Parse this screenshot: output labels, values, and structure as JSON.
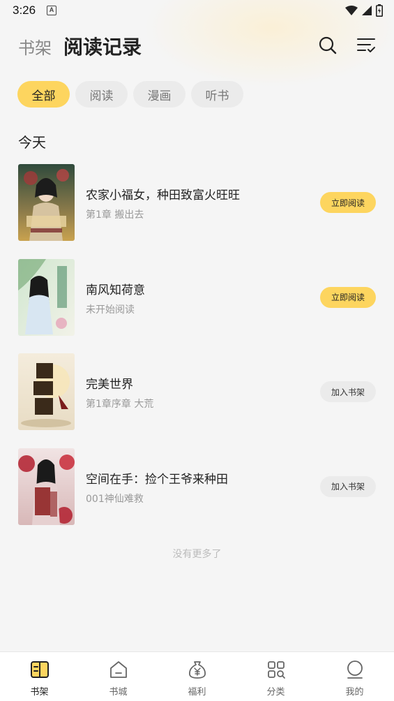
{
  "status": {
    "time": "3:26",
    "a_badge": "A"
  },
  "header": {
    "tab_shelf": "书架",
    "tab_history": "阅读记录",
    "search_icon": "search-icon",
    "manage_icon": "list-check-icon"
  },
  "filters": [
    {
      "label": "全部",
      "active": true
    },
    {
      "label": "阅读",
      "active": false
    },
    {
      "label": "漫画",
      "active": false
    },
    {
      "label": "听书",
      "active": false
    }
  ],
  "section_title": "今天",
  "books": [
    {
      "title": "农家小福女，种田致富火旺旺",
      "subtitle": "第1章 搬出去",
      "action": "立即阅读",
      "action_type": "read"
    },
    {
      "title": "南风知荷意",
      "subtitle": "未开始阅读",
      "action": "立即阅读",
      "action_type": "read"
    },
    {
      "title": "完美世界",
      "subtitle": "第1章序章 大荒",
      "action": "加入书架",
      "action_type": "add"
    },
    {
      "title": "空间在手：捡个王爷来种田",
      "subtitle": "001神仙难救",
      "action": "加入书架",
      "action_type": "add"
    }
  ],
  "no_more": "没有更多了",
  "nav": [
    {
      "label": "书架",
      "icon": "bookshelf-icon",
      "active": true
    },
    {
      "label": "书城",
      "icon": "store-icon",
      "active": false
    },
    {
      "label": "福利",
      "icon": "money-bag-icon",
      "active": false
    },
    {
      "label": "分类",
      "icon": "category-grid-icon",
      "active": false
    },
    {
      "label": "我的",
      "icon": "profile-icon",
      "active": false
    }
  ],
  "colors": {
    "accent": "#fdd55f",
    "chip_bg": "#ebebeb",
    "page_bg": "#f5f5f5"
  }
}
